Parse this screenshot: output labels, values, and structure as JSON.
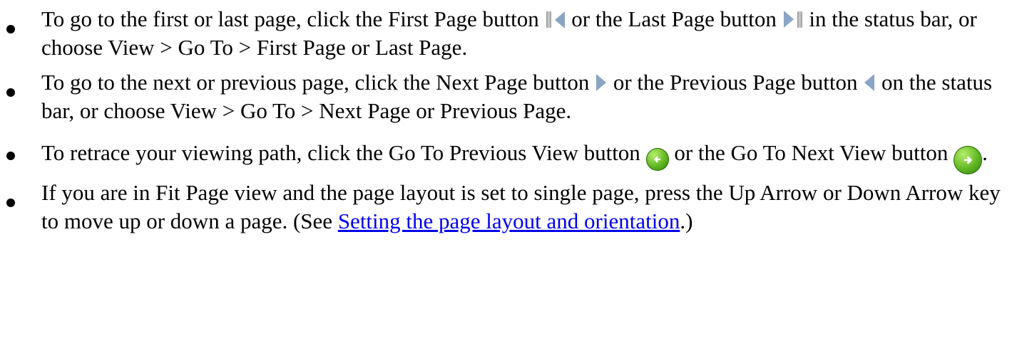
{
  "items": [
    {
      "p1": "To go to the first or last page, click the First Page button",
      "p2": "or the Last Page button",
      "p3": "in the status bar, or choose View > Go To > First Page or Last Page."
    },
    {
      "p1": "To go to the next or previous page, click the Next Page button",
      "p2": "or the Previous Page button",
      "p3": "on the status bar, or choose View > Go To > Next Page or Previous Page."
    },
    {
      "p1": "To retrace your viewing path, click the Go To Previous View button",
      "p2": "or the Go To",
      "p3": "Next View button",
      "p4": "."
    },
    {
      "p1": "If you are in Fit Page view and the page layout is set to single page, press the Up Arrow or Down Arrow key to move up or down a page. (See",
      "link": "Setting the page layout and orientation",
      "p2": ".)"
    }
  ],
  "icons": {
    "first_page": "first-page-icon",
    "last_page": "last-page-icon",
    "next_page": "next-page-icon",
    "previous_page": "previous-page-icon",
    "previous_view": "go-to-previous-view-icon",
    "next_view": "go-to-next-view-icon"
  },
  "colors": {
    "link": "#0000ee",
    "nav_icon": "#8aa4c4",
    "view_icon": "#5fb521"
  }
}
